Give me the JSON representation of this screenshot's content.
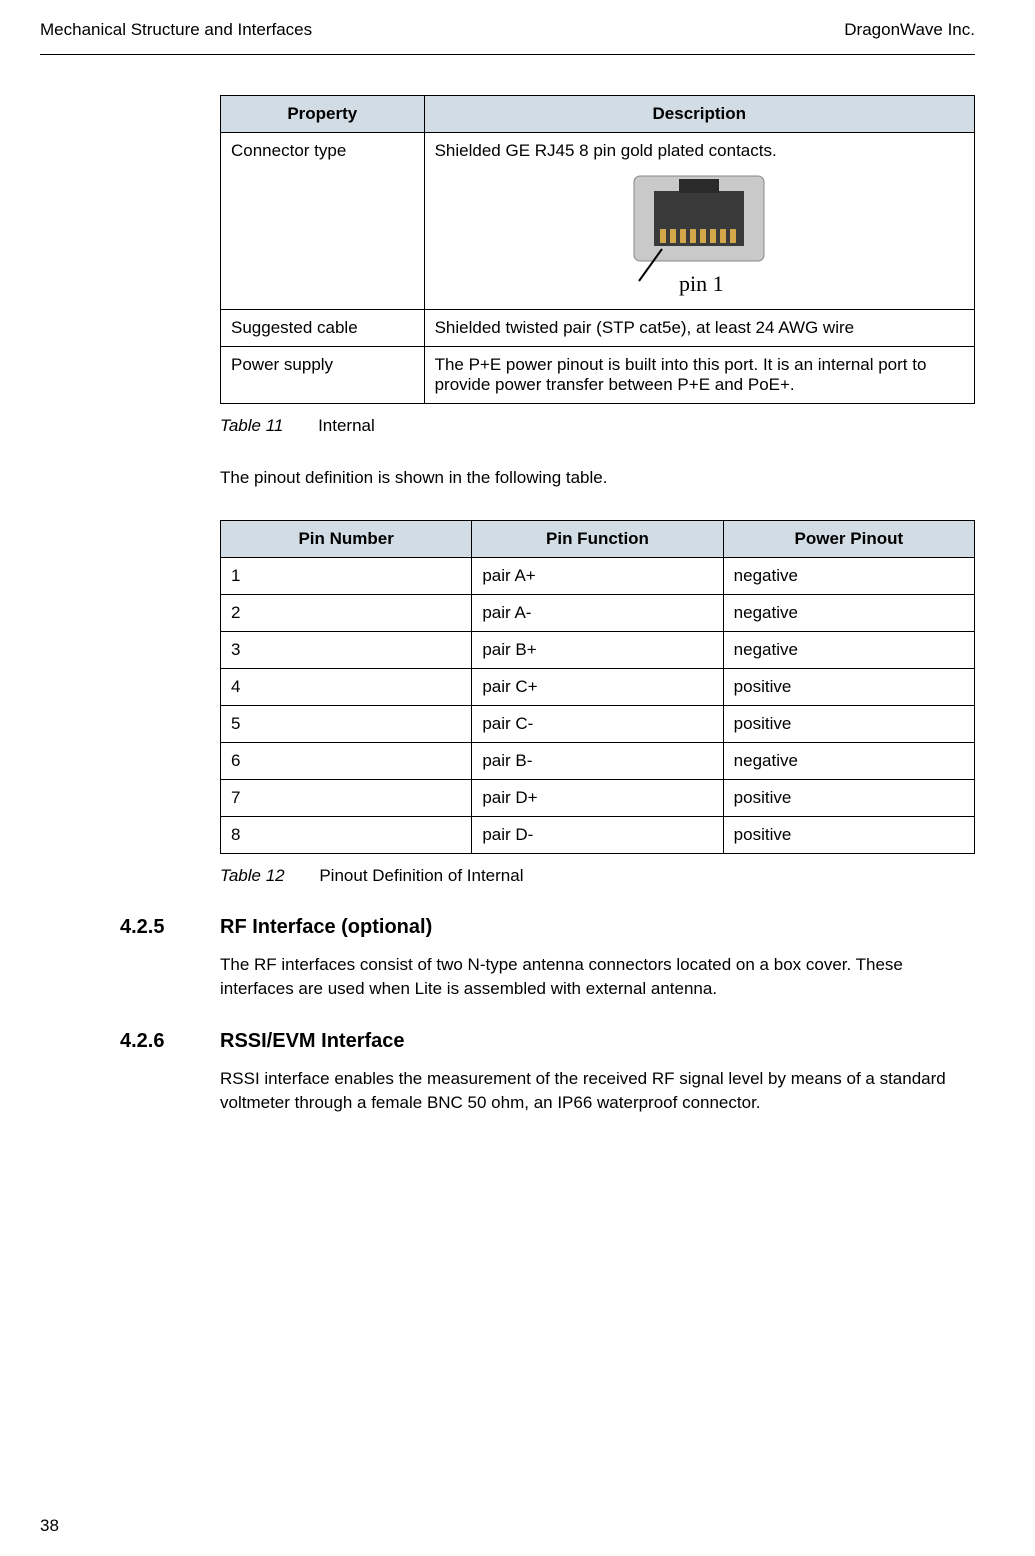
{
  "header": {
    "left": "Mechanical Structure and Interfaces",
    "right": "DragonWave Inc."
  },
  "table11": {
    "headers": {
      "property": "Property",
      "description": "Description"
    },
    "rows": [
      {
        "property": "Connector type",
        "description": "Shielded GE RJ45 8 pin gold plated contacts.",
        "has_image": true,
        "pin_label": "pin 1"
      },
      {
        "property": "Suggested cable",
        "description": "Shielded twisted pair (STP cat5e), at least 24 AWG wire"
      },
      {
        "property": "Power supply",
        "description": "The P+E power pinout is built into this port. It is an internal port to provide power transfer between P+E and PoE+."
      }
    ],
    "caption_label": "Table 11",
    "caption_name": "Internal"
  },
  "intro_text": "The pinout definition is shown in the following table.",
  "table12": {
    "headers": {
      "pin_number": "Pin Number",
      "pin_function": "Pin Function",
      "power_pinout": "Power Pinout"
    },
    "rows": [
      {
        "pin_number": "1",
        "pin_function": "pair A+",
        "power_pinout": "negative"
      },
      {
        "pin_number": "2",
        "pin_function": "pair A-",
        "power_pinout": "negative"
      },
      {
        "pin_number": "3",
        "pin_function": "pair B+",
        "power_pinout": "negative"
      },
      {
        "pin_number": "4",
        "pin_function": "pair C+",
        "power_pinout": "positive"
      },
      {
        "pin_number": "5",
        "pin_function": "pair C-",
        "power_pinout": "positive"
      },
      {
        "pin_number": "6",
        "pin_function": "pair B-",
        "power_pinout": "negative"
      },
      {
        "pin_number": "7",
        "pin_function": "pair D+",
        "power_pinout": "positive"
      },
      {
        "pin_number": "8",
        "pin_function": "pair D-",
        "power_pinout": "positive"
      }
    ],
    "caption_label": "Table 12",
    "caption_name": "Pinout Definition of Internal"
  },
  "section_425": {
    "number": "4.2.5",
    "title": "RF Interface (optional)",
    "body": "The RF interfaces consist of two N-type antenna connectors located on a box cover. These interfaces are used when Lite is assembled with external antenna."
  },
  "section_426": {
    "number": "4.2.6",
    "title": "RSSI/EVM Interface",
    "body": "RSSI interface enables the measurement of the received RF signal level by means of a standard voltmeter through a female BNC 50 ohm, an IP66 waterproof connector."
  },
  "page_number": "38"
}
